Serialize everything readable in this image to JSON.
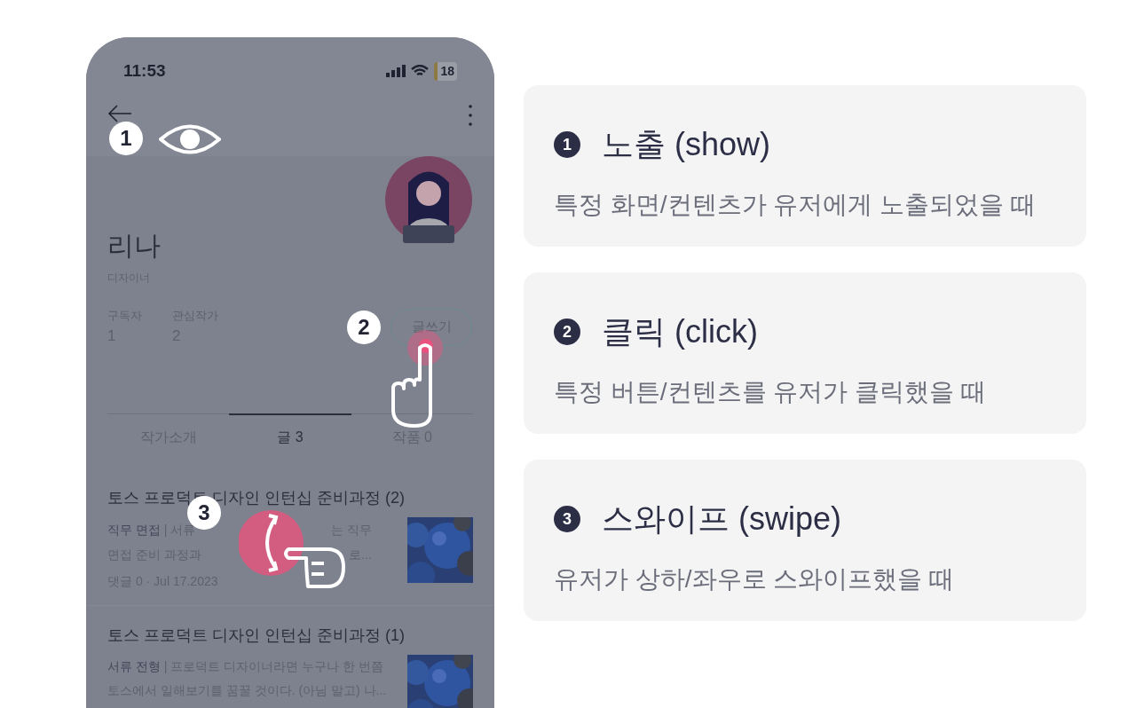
{
  "phone": {
    "status_bar": {
      "time": "11:53",
      "battery": "18"
    },
    "profile": {
      "name": "리나",
      "role": "디자이너",
      "stats": [
        {
          "label": "구독자",
          "value": "1"
        },
        {
          "label": "관심작가",
          "value": "2"
        }
      ],
      "write_button": "글쓰기"
    },
    "tabs": [
      {
        "label": "작가소개",
        "selected": false
      },
      {
        "label": "글 3",
        "selected": true
      },
      {
        "label": "작품 0",
        "selected": false
      }
    ],
    "posts": [
      {
        "title": "토스 프로덕트 디자인 인턴십 준비과정 (2)",
        "tag": "직무 면접",
        "lines": [
          [
            "| 서류",
            "는 직무"
          ],
          [
            "면접 준비 과정과",
            "로..."
          ]
        ],
        "meta": "댓글 0 · Jul 17.2023"
      },
      {
        "title": "토스 프로덕트 디자인 인턴십 준비과정 (1)",
        "tag": "서류 전형",
        "excerpt": "| 프로덕트 디자이너라면 누구나 한 번쯤 토스에서 일해보기를 꿈꿀 것이다. (아님 말고) 나..."
      }
    ],
    "markers": [
      {
        "number": "1",
        "kind": "show"
      },
      {
        "number": "2",
        "kind": "click"
      },
      {
        "number": "3",
        "kind": "swipe"
      }
    ]
  },
  "cards": [
    {
      "number": "1",
      "title": "노출 (show)",
      "description": "특정 화면/컨텐츠가 유저에게 노출되었을 때"
    },
    {
      "number": "2",
      "title": "클릭 (click)",
      "description": "특정 버튼/컨텐츠를 유저가 클릭했을 때"
    },
    {
      "number": "3",
      "title": "스와이프 (swipe)",
      "description": "유저가 상하/좌우로 스와이프했을 때"
    }
  ]
}
